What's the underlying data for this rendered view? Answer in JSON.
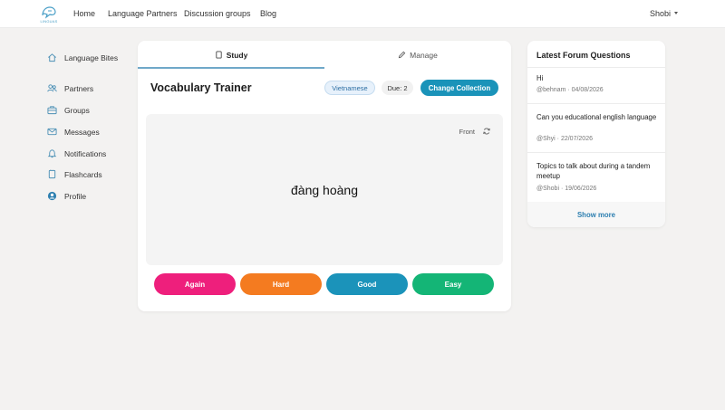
{
  "nav": {
    "logo_text": "LINGUAS",
    "links": [
      "Home",
      "Language Partners",
      "Discussion groups",
      "Blog"
    ],
    "user": "Shobi"
  },
  "sidebar": {
    "items": [
      {
        "label": "Language Bites",
        "icon": "home-icon"
      },
      {
        "label": "Partners",
        "icon": "users-icon"
      },
      {
        "label": "Groups",
        "icon": "briefcase-icon"
      },
      {
        "label": "Messages",
        "icon": "mail-icon"
      },
      {
        "label": "Notifications",
        "icon": "bell-icon"
      },
      {
        "label": "Flashcards",
        "icon": "cards-icon"
      },
      {
        "label": "Profile",
        "icon": "profile-icon"
      }
    ]
  },
  "trainer": {
    "tabs": [
      "Study",
      "Manage"
    ],
    "title": "Vocabulary Trainer",
    "language": "Vietnamese",
    "due": "Due: 2",
    "change_label": "Change Collection",
    "side_label": "Front",
    "word": "đàng hoàng",
    "grades": [
      {
        "label": "Again",
        "color": "#ee1f7c"
      },
      {
        "label": "Hard",
        "color": "#f47b20"
      },
      {
        "label": "Good",
        "color": "#1b93ba"
      },
      {
        "label": "Easy",
        "color": "#14b576"
      }
    ]
  },
  "forum": {
    "title": "Latest Forum Questions",
    "questions": [
      {
        "text": "Hi",
        "meta": "@behnam · 04/08/2026"
      },
      {
        "text": "Can you educational english language",
        "meta": "@Shyi · 22/07/2026"
      },
      {
        "text": "Topics to talk about during a tandem meetup",
        "meta": "@Shobi · 19/06/2026"
      }
    ],
    "show_more": "Show more"
  },
  "colors": {
    "accent": "#1a93b9",
    "tab_underline": "#6fa8c9",
    "background": "#f3f2f1"
  }
}
